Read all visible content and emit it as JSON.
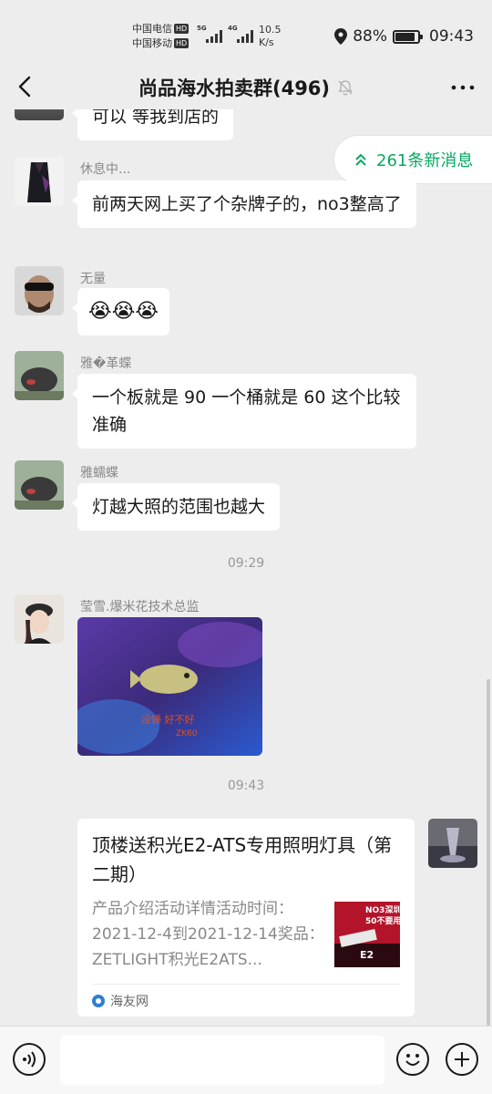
{
  "status_bar": {
    "carrier1": "中国电信",
    "carrier2": "中国移动",
    "hd": "HD",
    "net1": "5G",
    "net2": "4G",
    "speed_value": "10.5",
    "speed_unit": "K/s",
    "battery_percent": "88%",
    "battery_level": 0.88,
    "time": "09:43"
  },
  "nav": {
    "title": "尚品海水拍卖群(496)"
  },
  "new_messages": {
    "label": "261条新消息"
  },
  "messages": [
    {
      "type": "text",
      "text": "可以 等我到店的"
    },
    {
      "type": "text",
      "nick": "休息中...",
      "text": "前两天网上买了个杂牌子的，no3整高了"
    },
    {
      "type": "emoji",
      "nick": "无量",
      "text": "😭😭😭"
    },
    {
      "type": "text",
      "nick": "雅�革蝶",
      "text": "一个板就是 90 一个桶就是 60 这个比较准确"
    },
    {
      "type": "text",
      "nick": "雅蠕蝶",
      "text": "灯越大照的范围也越大"
    },
    {
      "type": "time",
      "text": "09:29"
    },
    {
      "type": "image",
      "nick": "莹雪.爆米花技术总监",
      "image_text": "没锤 好不好\nZK60"
    },
    {
      "type": "time",
      "text": "09:43"
    },
    {
      "type": "link_card",
      "title": "顶楼送积光E2-ATS专用照明灯具（第二期）",
      "desc": "产品介绍活动详情活动时间：2021-12-4到2021-12-14奖品：ZETLIGHT积光E2ATS...",
      "thumb_text1": "NO3深圳",
      "thumb_text2": "50不要用",
      "thumb_text3": "E2",
      "source": "海友网"
    }
  ],
  "input": {
    "placeholder": ""
  }
}
